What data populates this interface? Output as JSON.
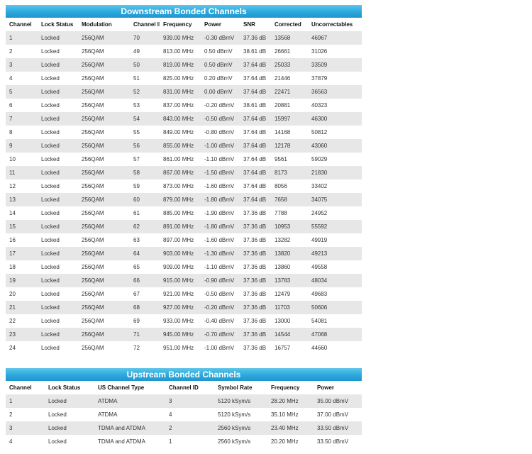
{
  "downstream": {
    "title": "Downstream Bonded Channels",
    "headers": [
      "Channel",
      "Lock Status",
      "Modulation",
      "Channel ID",
      "Frequency",
      "Power",
      "SNR",
      "Corrected",
      "Uncorrectables"
    ],
    "rows": [
      [
        "1",
        "Locked",
        "256QAM",
        "70",
        "939.00 MHz",
        "-0.30 dBmV",
        "37.36 dB",
        "13568",
        "46967"
      ],
      [
        "2",
        "Locked",
        "256QAM",
        "49",
        "813.00 MHz",
        "0.50 dBmV",
        "38.61 dB",
        "26661",
        "31026"
      ],
      [
        "3",
        "Locked",
        "256QAM",
        "50",
        "819.00 MHz",
        "0.50 dBmV",
        "37.64 dB",
        "25033",
        "33509"
      ],
      [
        "4",
        "Locked",
        "256QAM",
        "51",
        "825.00 MHz",
        "0.20 dBmV",
        "37.64 dB",
        "21446",
        "37879"
      ],
      [
        "5",
        "Locked",
        "256QAM",
        "52",
        "831.00 MHz",
        "0.00 dBmV",
        "37.64 dB",
        "22471",
        "36563"
      ],
      [
        "6",
        "Locked",
        "256QAM",
        "53",
        "837.00 MHz",
        "-0.20 dBmV",
        "38.61 dB",
        "20881",
        "40323"
      ],
      [
        "7",
        "Locked",
        "256QAM",
        "54",
        "843.00 MHz",
        "-0.50 dBmV",
        "37.64 dB",
        "15997",
        "46300"
      ],
      [
        "8",
        "Locked",
        "256QAM",
        "55",
        "849.00 MHz",
        "-0.80 dBmV",
        "37.64 dB",
        "14168",
        "50812"
      ],
      [
        "9",
        "Locked",
        "256QAM",
        "56",
        "855.00 MHz",
        "-1.00 dBmV",
        "37.64 dB",
        "12178",
        "43060"
      ],
      [
        "10",
        "Locked",
        "256QAM",
        "57",
        "861.00 MHz",
        "-1.10 dBmV",
        "37.64 dB",
        "9561",
        "59029"
      ],
      [
        "11",
        "Locked",
        "256QAM",
        "58",
        "867.00 MHz",
        "-1.50 dBmV",
        "37.64 dB",
        "8173",
        "21830"
      ],
      [
        "12",
        "Locked",
        "256QAM",
        "59",
        "873.00 MHz",
        "-1.60 dBmV",
        "37.64 dB",
        "8056",
        "33402"
      ],
      [
        "13",
        "Locked",
        "256QAM",
        "60",
        "879.00 MHz",
        "-1.80 dBmV",
        "37.64 dB",
        "7658",
        "34075"
      ],
      [
        "14",
        "Locked",
        "256QAM",
        "61",
        "885.00 MHz",
        "-1.90 dBmV",
        "37.36 dB",
        "7788",
        "24952"
      ],
      [
        "15",
        "Locked",
        "256QAM",
        "62",
        "891.00 MHz",
        "-1.80 dBmV",
        "37.36 dB",
        "10953",
        "55592"
      ],
      [
        "16",
        "Locked",
        "256QAM",
        "63",
        "897.00 MHz",
        "-1.60 dBmV",
        "37.36 dB",
        "13282",
        "49919"
      ],
      [
        "17",
        "Locked",
        "256QAM",
        "64",
        "903.00 MHz",
        "-1.30 dBmV",
        "37.36 dB",
        "13820",
        "49213"
      ],
      [
        "18",
        "Locked",
        "256QAM",
        "65",
        "909.00 MHz",
        "-1.10 dBmV",
        "37.36 dB",
        "13860",
        "49558"
      ],
      [
        "19",
        "Locked",
        "256QAM",
        "66",
        "915.00 MHz",
        "-0.90 dBmV",
        "37.36 dB",
        "13783",
        "48034"
      ],
      [
        "20",
        "Locked",
        "256QAM",
        "67",
        "921.00 MHz",
        "-0.50 dBmV",
        "37.36 dB",
        "12479",
        "49683"
      ],
      [
        "21",
        "Locked",
        "256QAM",
        "68",
        "927.00 MHz",
        "-0.20 dBmV",
        "37.36 dB",
        "11703",
        "50606"
      ],
      [
        "22",
        "Locked",
        "256QAM",
        "69",
        "933.00 MHz",
        "-0.40 dBmV",
        "37.36 dB",
        "13000",
        "54081"
      ],
      [
        "23",
        "Locked",
        "256QAM",
        "71",
        "945.00 MHz",
        "-0.70 dBmV",
        "37.36 dB",
        "14544",
        "47068"
      ],
      [
        "24",
        "Locked",
        "256QAM",
        "72",
        "951.00 MHz",
        "-1.00 dBmV",
        "37.36 dB",
        "16757",
        "44660"
      ]
    ]
  },
  "upstream": {
    "title": "Upstream Bonded Channels",
    "headers": [
      "Channel",
      "Lock Status",
      "US Channel Type",
      "Channel ID",
      "Symbol Rate",
      "Frequency",
      "Power"
    ],
    "rows": [
      [
        "1",
        "Locked",
        "ATDMA",
        "3",
        "5120 kSym/s",
        "28.20 MHz",
        "35.00 dBmV"
      ],
      [
        "2",
        "Locked",
        "ATDMA",
        "4",
        "5120 kSym/s",
        "35.10 MHz",
        "37.00 dBmV"
      ],
      [
        "3",
        "Locked",
        "TDMA and ATDMA",
        "2",
        "2560 kSym/s",
        "23.40 MHz",
        "33.50 dBmV"
      ],
      [
        "4",
        "Locked",
        "TDMA and ATDMA",
        "1",
        "2560 kSym/s",
        "20.20 MHz",
        "33.50 dBmV"
      ]
    ]
  },
  "colors": {
    "title_bar": "#2ba8dd",
    "row_shade": "#e7e7e7"
  }
}
